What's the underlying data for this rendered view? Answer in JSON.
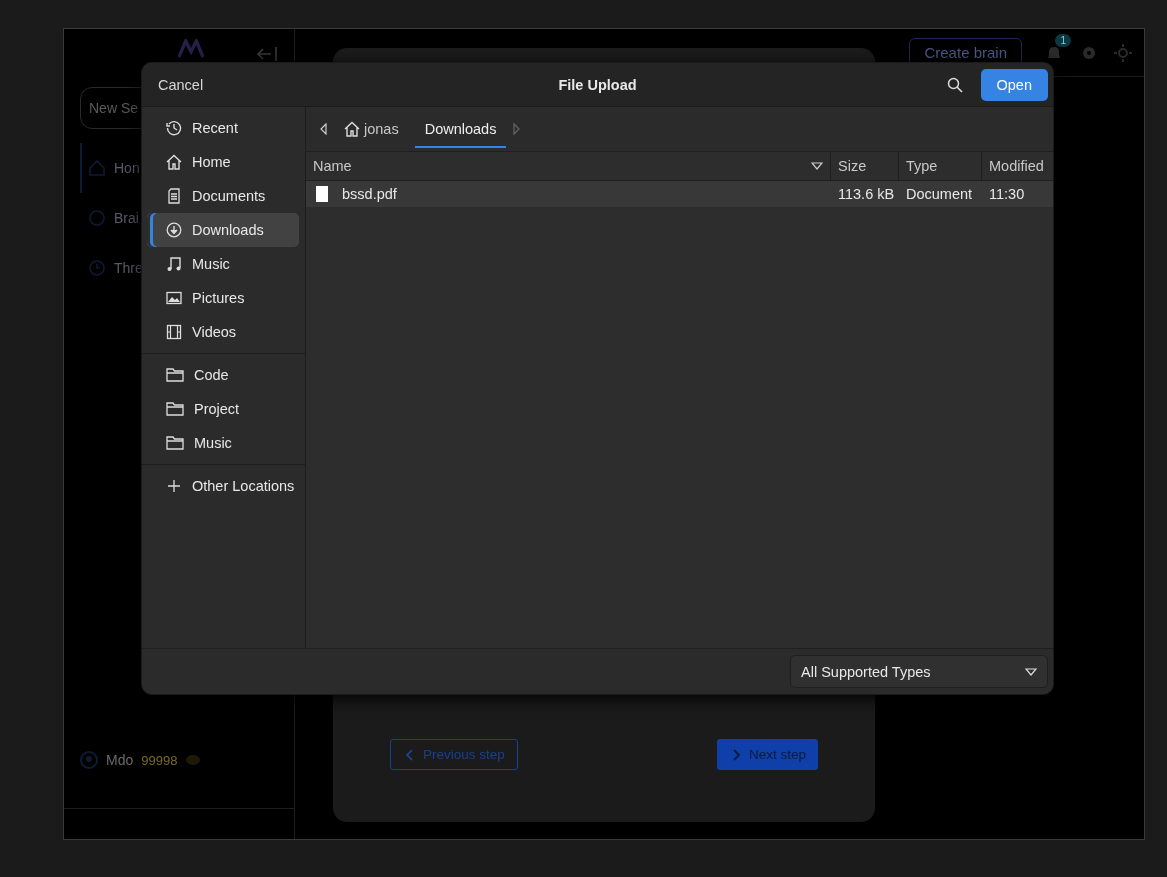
{
  "app": {
    "sidebar": {
      "new_search": "New Se",
      "items": [
        {
          "label": "Hon",
          "selected": true
        },
        {
          "label": "Brai",
          "selected": false
        },
        {
          "label": "Thre",
          "selected": false
        }
      ],
      "user": {
        "name": "Mdo",
        "credits": "99998"
      }
    },
    "header": {
      "create_button": "Create brain",
      "notification_count": "1"
    },
    "wizard": {
      "previous": "Previous step",
      "next": "Next step"
    }
  },
  "dialog": {
    "cancel": "Cancel",
    "title": "File Upload",
    "open": "Open",
    "places": [
      {
        "label": "Recent",
        "selected": false
      },
      {
        "label": "Home",
        "selected": false
      },
      {
        "label": "Documents",
        "selected": false
      },
      {
        "label": "Downloads",
        "selected": true
      },
      {
        "label": "Music",
        "selected": false
      },
      {
        "label": "Pictures",
        "selected": false
      },
      {
        "label": "Videos",
        "selected": false
      }
    ],
    "bookmarks": [
      {
        "label": "Code",
        "selected": false
      },
      {
        "label": "Project",
        "selected": false
      },
      {
        "label": "Music",
        "selected": false
      }
    ],
    "other_locations": "Other Locations",
    "path": [
      {
        "label": "jonas",
        "kind": "home",
        "selected": false
      },
      {
        "label": "Downloads",
        "kind": "folder",
        "selected": true
      }
    ],
    "columns": [
      "Name",
      "Size",
      "Type",
      "Modified"
    ],
    "files": [
      {
        "name": "bssd.pdf",
        "size": "113.6 kB",
        "type": "Document",
        "modified": "11:30"
      }
    ],
    "filter": "All Supported Types"
  }
}
